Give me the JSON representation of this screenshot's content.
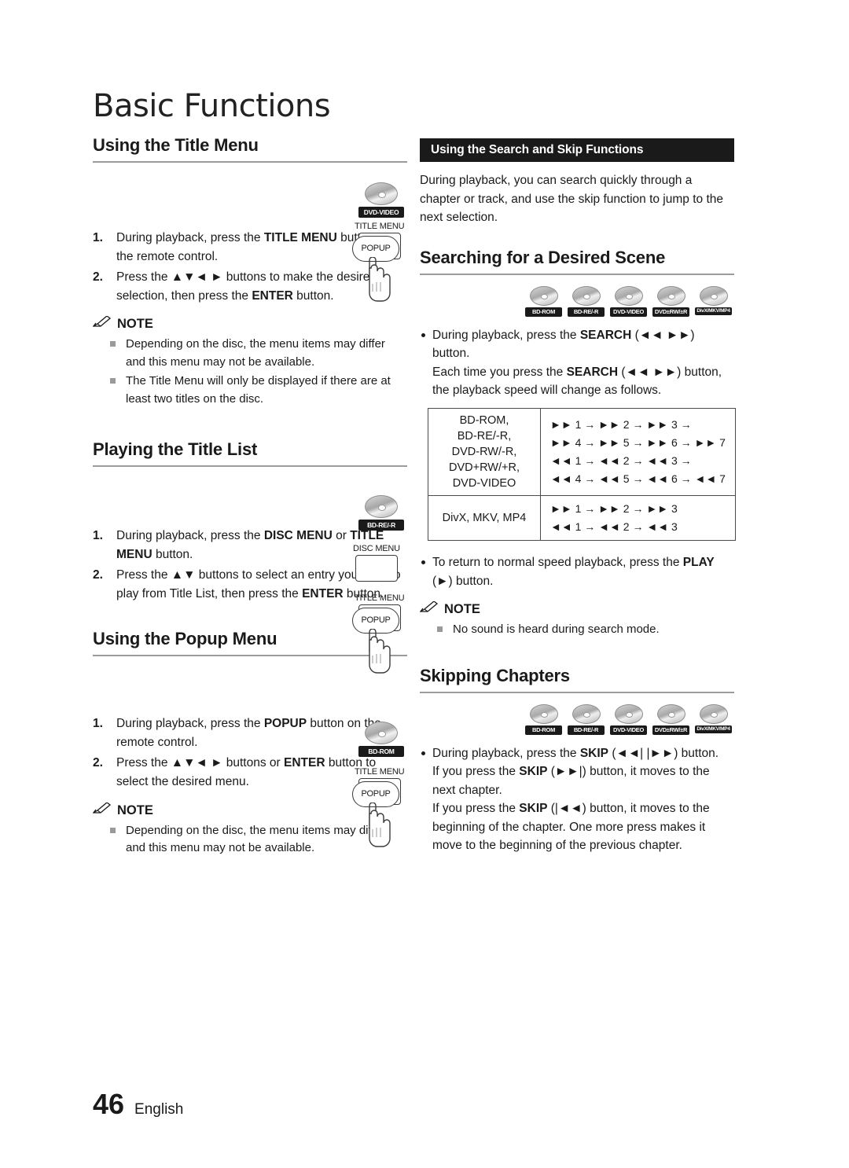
{
  "page": {
    "chapter_title": "Basic Functions",
    "number": "46",
    "language": "English"
  },
  "left_column": {
    "sections": [
      {
        "heading": "Using the Title Menu",
        "steps": [
          {
            "num": "1.",
            "text_parts": [
              "During playback, press the ",
              "TITLE MENU",
              " button on the remote control."
            ]
          },
          {
            "num": "2.",
            "text_parts": [
              "Press the ▲▼◄ ► buttons to make the desired selection, then press the ",
              "ENTER",
              " button."
            ]
          }
        ],
        "note_label": "NOTE",
        "notes": [
          "Depending on the disc, the menu items may differ and this menu may not be available.",
          "The Title Menu will only be displayed if there are at least two titles on the disc."
        ],
        "art": {
          "disc_label": "DVD-VIDEO",
          "title_menu_label": "TITLE MENU",
          "popup_label": "POPUP"
        }
      },
      {
        "heading": "Playing the Title List",
        "steps": [
          {
            "num": "1.",
            "text_parts": [
              "During playback, press the ",
              "DISC MENU",
              " or ",
              "TITLE MENU",
              " button."
            ]
          },
          {
            "num": "2.",
            "text_parts": [
              "Press the ▲▼ buttons to select an entry you want to play from Title List, then press the ",
              "ENTER",
              " button."
            ]
          }
        ],
        "art": {
          "disc_label": "BD-RE/-R",
          "disc_menu_label": "DISC MENU",
          "title_menu_label": "TITLE MENU",
          "popup_label": "POPUP"
        }
      },
      {
        "heading": "Using the Popup Menu",
        "steps": [
          {
            "num": "1.",
            "text_parts": [
              "During playback, press the ",
              "POPUP",
              " button on the remote control."
            ]
          },
          {
            "num": "2.",
            "text_parts": [
              "Press the ▲▼◄ ► buttons or ",
              "ENTER",
              " button to select the desired menu."
            ]
          }
        ],
        "note_label": "NOTE",
        "notes": [
          "Depending on the disc, the menu items may differ and this menu may not be available."
        ],
        "art": {
          "disc_label": "BD-ROM",
          "title_menu_label": "TITLE MENU",
          "popup_label": "POPUP"
        }
      }
    ]
  },
  "right_column": {
    "banner": "Using the Search and Skip Functions",
    "intro": "During playback, you can search quickly through a chapter or track, and use the skip function to jump to the next selection.",
    "search_section": {
      "heading": "Searching for a Desired Scene",
      "discs": [
        "BD-ROM",
        "BD-RE/-R",
        "DVD-VIDEO",
        "DVD±RW/±R",
        "DivX/MKV/MP4"
      ],
      "bullet_parts": [
        "During playback, press the ",
        "SEARCH",
        " (◄◄ ►►) button."
      ],
      "bullet_line2_parts": [
        "Each time you press the ",
        "SEARCH",
        " (◄◄ ►►) button, the playback speed will change as follows."
      ],
      "table": {
        "rows": [
          {
            "label": "BD-ROM,\nBD-RE/-R,\nDVD-RW/-R,\nDVD+RW/+R,\nDVD-VIDEO",
            "label_lines": [
              "BD-ROM,",
              "BD-RE/-R,",
              "DVD-RW/-R,",
              "DVD+RW/+R,",
              "DVD-VIDEO"
            ],
            "value_lines": [
              "►► 1 → ►► 2 → ►► 3 →",
              "►► 4 → ►► 5 → ►► 6 → ►► 7",
              "◄◄ 1 → ◄◄ 2 → ◄◄ 3 →",
              "◄◄ 4 → ◄◄ 5 → ◄◄ 6 → ◄◄ 7"
            ]
          },
          {
            "label_lines": [
              "DivX, MKV, MP4"
            ],
            "value_lines": [
              "►► 1 → ►► 2 → ►► 3",
              "◄◄ 1 → ◄◄ 2 → ◄◄ 3"
            ]
          }
        ]
      },
      "bullet2_parts": [
        "To return to normal speed playback, press the ",
        "PLAY",
        " (►) button."
      ],
      "note_label": "NOTE",
      "notes": [
        "No sound is heard during search mode."
      ]
    },
    "skip_section": {
      "heading": "Skipping Chapters",
      "discs": [
        "BD-ROM",
        "BD-RE/-R",
        "DVD-VIDEO",
        "DVD±RW/±R",
        "DivX/MKV/MP4"
      ],
      "bullet_parts": [
        "During playback, press the ",
        "SKIP",
        " (◄◄| |►►) button."
      ],
      "body_lines": [
        {
          "parts": [
            "If you press the ",
            "SKIP",
            " (►►|) button, it moves to the next chapter."
          ]
        },
        {
          "parts": [
            "If you press the ",
            "SKIP",
            " (|◄◄) button, it moves to the beginning of the chapter. One more press makes it move to the beginning of the previous chapter."
          ]
        }
      ]
    }
  }
}
